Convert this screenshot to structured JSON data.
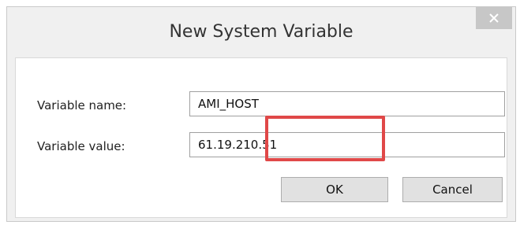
{
  "dialog": {
    "title": "New System Variable",
    "close_icon": "close-icon"
  },
  "form": {
    "name_label": "Variable name:",
    "name_value": "AMI_HOST",
    "value_label": "Variable value:",
    "value_value": "61.19.210.51"
  },
  "buttons": {
    "ok_label": "OK",
    "cancel_label": "Cancel"
  },
  "colors": {
    "highlight": "#e04848",
    "close_bg": "#c7c7c7"
  }
}
